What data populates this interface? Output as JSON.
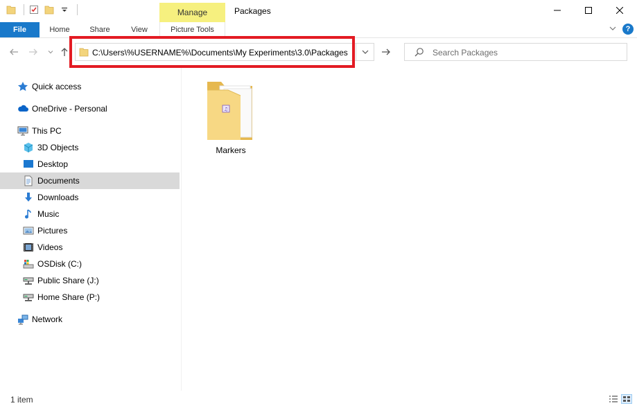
{
  "window": {
    "title": "Packages",
    "manage_tab": "Manage"
  },
  "ribbon": {
    "tabs": [
      {
        "label": "File"
      },
      {
        "label": "Home"
      },
      {
        "label": "Share"
      },
      {
        "label": "View"
      },
      {
        "label": "Picture Tools"
      }
    ]
  },
  "navigation": {
    "address": "C:\\Users\\%USERNAME%\\Documents\\My Experiments\\3.0\\Packages",
    "search_placeholder": "Search Packages"
  },
  "sidebar": {
    "items": [
      {
        "label": "Quick access",
        "icon": "star-icon"
      },
      {
        "label": "OneDrive - Personal",
        "icon": "cloud-icon"
      },
      {
        "label": "This PC",
        "icon": "computer-icon"
      },
      {
        "label": "3D Objects",
        "icon": "cube-icon"
      },
      {
        "label": "Desktop",
        "icon": "desktop-icon"
      },
      {
        "label": "Documents",
        "icon": "document-icon",
        "selected": true
      },
      {
        "label": "Downloads",
        "icon": "download-icon"
      },
      {
        "label": "Music",
        "icon": "music-icon"
      },
      {
        "label": "Pictures",
        "icon": "pictures-icon"
      },
      {
        "label": "Videos",
        "icon": "video-icon"
      },
      {
        "label": "OSDisk (C:)",
        "icon": "disk-icon"
      },
      {
        "label": "Public Share (J:)",
        "icon": "network-drive-icon"
      },
      {
        "label": "Home Share (P:)",
        "icon": "network-drive-icon"
      },
      {
        "label": "Network",
        "icon": "network-icon"
      }
    ]
  },
  "content": {
    "items": [
      {
        "name": "Markers",
        "type": "folder"
      }
    ]
  },
  "status": {
    "item_count": "1 item"
  },
  "colors": {
    "accent": "#1979ca",
    "manage_tab": "#f6f07f",
    "highlight_border": "#e31b23",
    "selected_row": "#d9d9d9",
    "folder": "#f3d47c"
  }
}
